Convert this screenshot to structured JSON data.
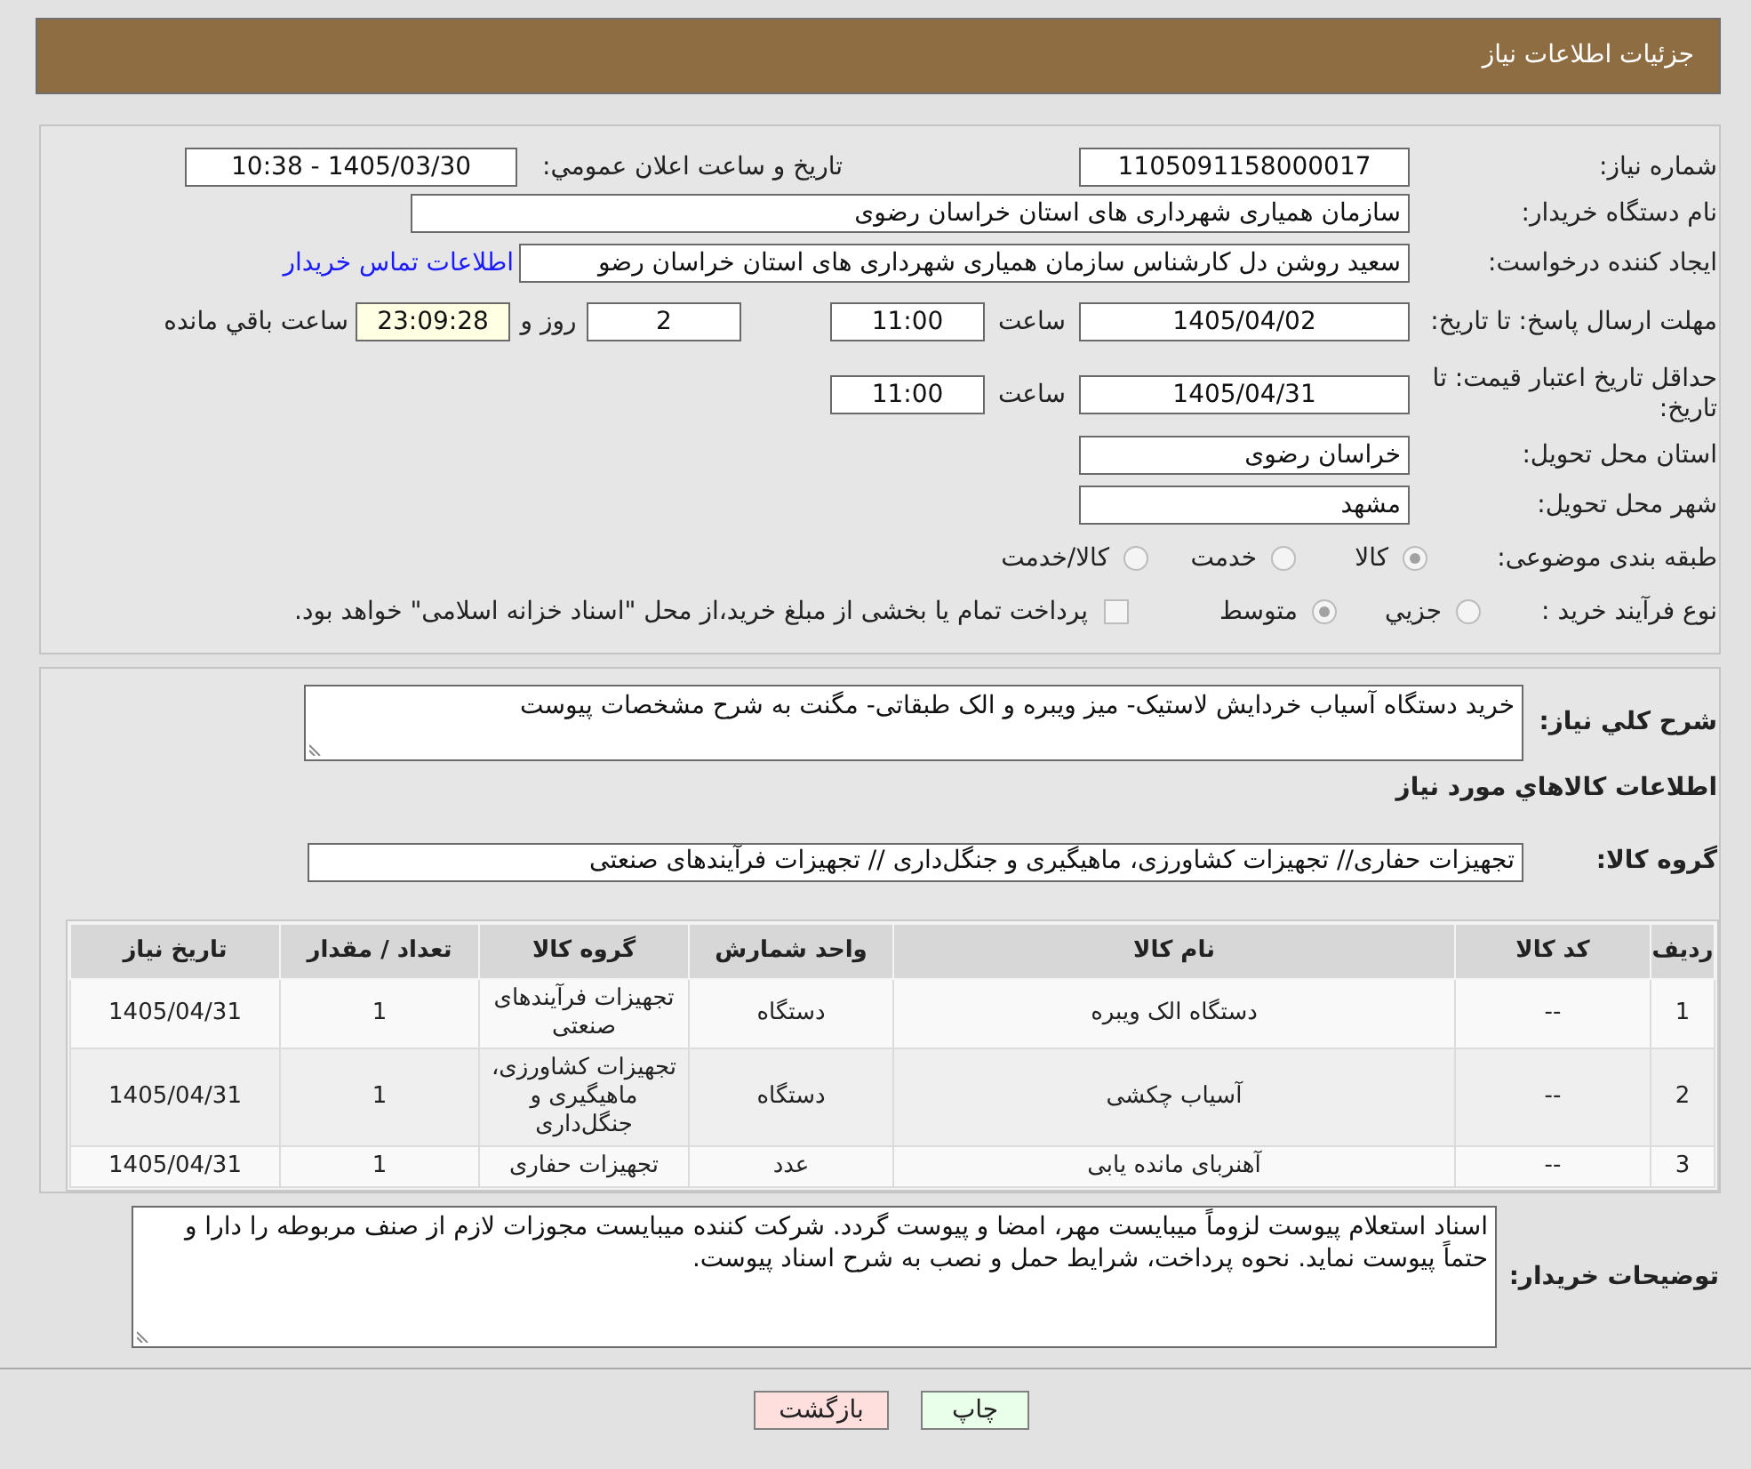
{
  "header": {
    "title": "جزئیات اطلاعات نیاز"
  },
  "details": {
    "need_number": {
      "label": "شماره نیاز:",
      "value": "1105091158000017"
    },
    "announcement": {
      "label": "تاریخ و ساعت اعلان عمومي:",
      "value": "1405/03/30 - 10:38"
    },
    "buyer_organization": {
      "label": "نام دستگاه خریدار:",
      "value": "سازمان همیاری شهرداری های استان خراسان رضوی"
    },
    "requester": {
      "label": "ایجاد کننده درخواست:",
      "value": "سعید روشن دل کارشناس سازمان همیاری شهرداری های استان خراسان رضو",
      "contact_link": "اطلاعات تماس خریدار"
    },
    "response_deadline": {
      "label": "مهلت ارسال پاسخ: تا تاریخ:",
      "date": "1405/04/02",
      "time_label": "ساعت",
      "time": "11:00",
      "days": "2",
      "days_label": "روز و",
      "remaining": "23:09:28",
      "remaining_label": "ساعت باقي مانده"
    },
    "price_validity": {
      "label": "حداقل تاریخ اعتبار قیمت: تا تاریخ:",
      "date": "1405/04/31",
      "time_label": "ساعت",
      "time": "11:00"
    },
    "delivery_province": {
      "label": "استان محل تحویل:",
      "value": "خراسان رضوی"
    },
    "delivery_city": {
      "label": "شهر محل تحویل:",
      "value": "مشهد"
    },
    "subject_category": {
      "label": "طبقه بندی موضوعی:",
      "options": [
        {
          "label": "کالا",
          "selected": true
        },
        {
          "label": "خدمت",
          "selected": false
        },
        {
          "label": "کالا/خدمت",
          "selected": false
        }
      ]
    },
    "purchase_process": {
      "label": "نوع فرآیند خرید :",
      "options": [
        {
          "label": "جزيي",
          "selected": false
        },
        {
          "label": "متوسط",
          "selected": true
        }
      ],
      "treasury_payment": {
        "label": "پرداخت تمام یا بخشی از مبلغ خرید،از محل \"اسناد خزانه اسلامی\" خواهد بود.",
        "checked": false
      }
    }
  },
  "need_summary": {
    "label": "شرح کلي نیاز:",
    "value": "خرید دستگاه آسیاب خردایش لاستیک- میز ویبره و الک طبقاتی- مگنت به شرح مشخصات پیوست"
  },
  "goods_section_title": "اطلاعات کالاهاي مورد نیاز",
  "goods_group": {
    "label": "گروه کالا:",
    "value": "تجهیزات حفاری// تجهیزات کشاورزی، ماهیگیری و جنگل‌داری // تجهیزات فرآیندهای صنعتی"
  },
  "goods_table": {
    "columns": [
      "ردیف",
      "کد کالا",
      "نام کالا",
      "واحد شمارش",
      "گروه کالا",
      "تعداد / مقدار",
      "تاریخ نیاز"
    ],
    "rows": [
      [
        "1",
        "--",
        "دستگاه الک ویبره",
        "دستگاه",
        "تجهیزات فرآیندهای صنعتی",
        "1",
        "1405/04/31"
      ],
      [
        "2",
        "--",
        "آسیاب چکشی",
        "دستگاه",
        "تجهیزات کشاورزی، ماهیگیری و جنگل‌داری",
        "1",
        "1405/04/31"
      ],
      [
        "3",
        "--",
        "آهنربای مانده یابی",
        "عدد",
        "تجهیزات حفاری",
        "1",
        "1405/04/31"
      ]
    ]
  },
  "buyer_notes": {
    "label": "توضیحات خریدار:",
    "value": "اسناد استعلام پیوست لزوماً میبایست مهر، امضا و پیوست گردد. شرکت کننده میبایست مجوزات لازم از صنف مربوطه را دارا و حتماً پیوست نماید. نحوه پرداخت، شرایط حمل و نصب به شرح اسناد پیوست."
  },
  "buttons": [
    {
      "label": "چاپ",
      "kind": "print"
    },
    {
      "label": "بازگشت",
      "kind": "back"
    }
  ]
}
